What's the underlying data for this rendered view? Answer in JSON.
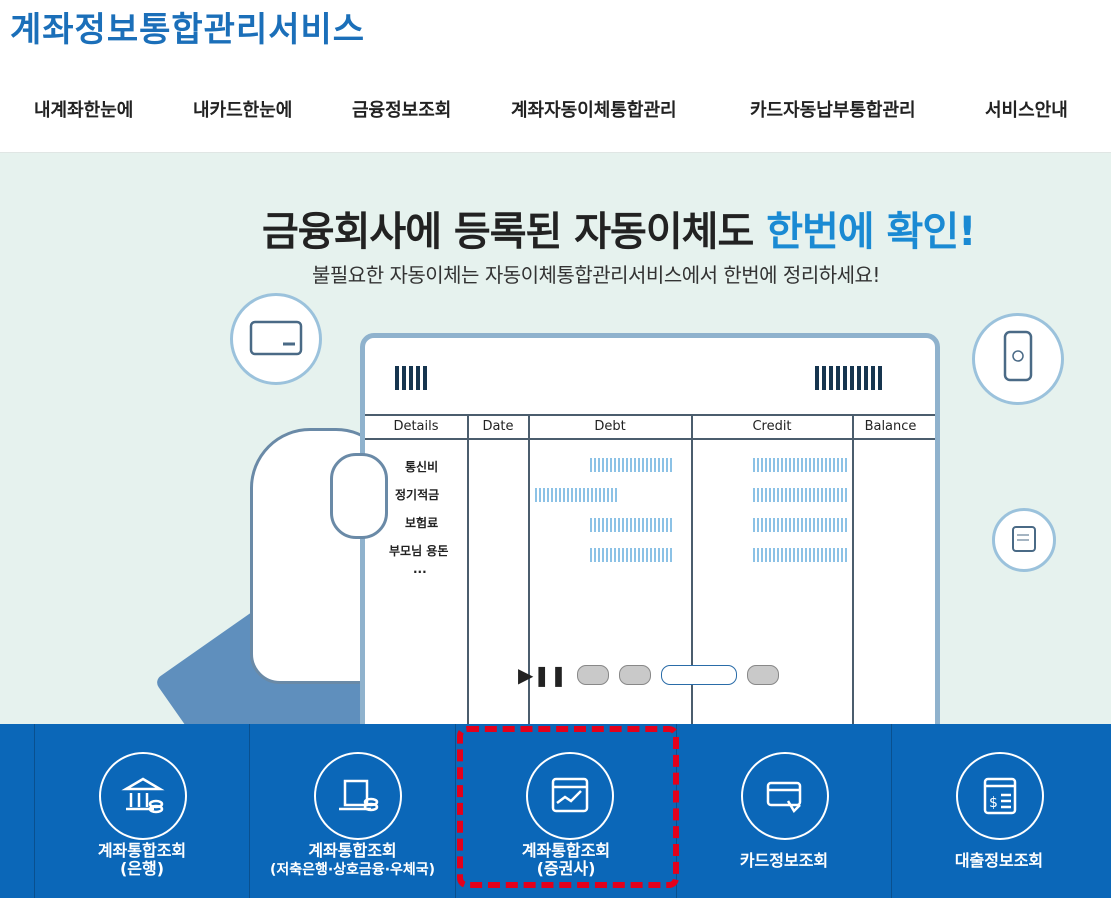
{
  "site_title": "계좌정보통합관리서비스",
  "nav": [
    "내계좌한눈에",
    "내카드한눈에",
    "금융정보조회",
    "계좌자동이체통합관리",
    "카드자동납부통합관리",
    "서비스안내"
  ],
  "banner": {
    "title_main": "금융회사에 등록된 자동이체도",
    "title_highlight": "한번에 확인!",
    "subtitle": "불필요한 자동이체는 자동이체통합관리서비스에서 한번에 정리하세요!",
    "table_headers": [
      "Details",
      "Date",
      "Debt",
      "Credit",
      "Balance"
    ],
    "table_rows": [
      "통신비",
      "정기적금",
      "보험료",
      "부모님 용돈",
      "..."
    ]
  },
  "slider": {
    "play_pause": "▶❚❚",
    "active_index": 2,
    "count": 4
  },
  "quick_menu": [
    {
      "label1": "계좌통합조회",
      "label2": "(은행)",
      "icon": "bank-icon"
    },
    {
      "label1": "계좌통합조회",
      "label2": "(저축은행·상호금융·우체국)",
      "icon": "laptop-icon"
    },
    {
      "label1": "계좌통합조회",
      "label2": "(증권사)",
      "icon": "stock-chart-icon"
    },
    {
      "label1": "카드정보조회",
      "label2": "",
      "icon": "card-icon"
    },
    {
      "label1": "대출정보조회",
      "label2": "",
      "icon": "loan-icon"
    }
  ],
  "colors": {
    "brand": "#1b6fb9",
    "quick_bg": "#0b67b8",
    "highlight": "#e3001b",
    "hero_bg": "#e6f2ee"
  }
}
